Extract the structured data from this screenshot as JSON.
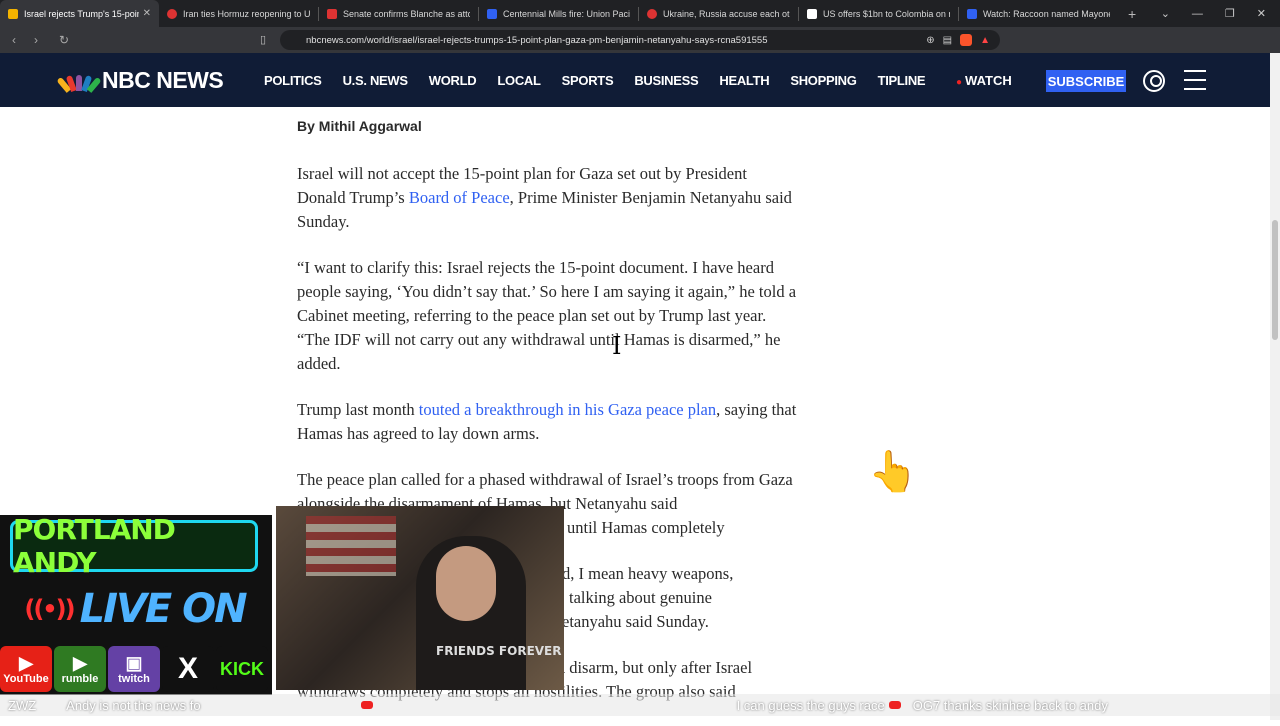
{
  "browser": {
    "tabs": [
      {
        "title": "Israel rejects Trump's 15-point p",
        "active": true,
        "favicon_color": "#f4b400"
      },
      {
        "title": "Iran ties Hormuz reopening to US c",
        "active": false,
        "favicon_color": "#d33"
      },
      {
        "title": "Senate confirms Blanche as attorne",
        "active": false,
        "favicon_color": "#d33"
      },
      {
        "title": "Centennial Mills fire: Union Pacific p",
        "active": false,
        "favicon_color": "#3061f2"
      },
      {
        "title": "Ukraine, Russia accuse each other o",
        "active": false,
        "favicon_color": "#d33"
      },
      {
        "title": "US offers $1bn to Colombia on new",
        "active": false,
        "favicon_color": "#fff"
      },
      {
        "title": "Watch: Raccoon named Mayonesia",
        "active": false,
        "favicon_color": "#3061f2"
      }
    ],
    "url": "nbcnews.com/world/israel/israel-rejects-trumps-15-point-plan-gaza-pm-benjamin-netanyahu-says-rcna591555"
  },
  "site": {
    "logo": "NBC NEWS",
    "nav": [
      "POLITICS",
      "U.S. NEWS",
      "WORLD",
      "LOCAL",
      "SPORTS",
      "BUSINESS",
      "HEALTH",
      "SHOPPING",
      "TIPLINE"
    ],
    "watch": "WATCH",
    "subscribe": "SUBSCRIBE"
  },
  "article": {
    "byline": "By Mithil Aggarwal",
    "p1_a": "Israel will not accept the 15-point plan for Gaza set out by President Donald Trump’s ",
    "p1_link": "Board of Peace",
    "p1_b": ", Prime Minister Benjamin Netanyahu said Sunday.",
    "p2": "“I want to clarify this: Israel rejects the 15-point document. I have heard people saying, ‘You didn’t say that.’ So here I am saying it again,” he told a Cabinet meeting, referring to the peace plan set out by Trump last year. “The IDF will not carry out any withdrawal until Hamas is disarmed,” he added.",
    "p3_a": "Trump last month ",
    "p3_link": "touted a breakthrough in his Gaza peace plan",
    "p3_b": ", saying that Hamas has agreed to lay down arms.",
    "p4": "The peace plan called for a phased withdrawal of Israel’s troops from Gaza alongside the disarmament of Hamas, but Netanyahu said",
    "p4_tail": "until Hamas completely",
    "p5_a": "d, I mean heavy weapons,",
    "p5_b": "talking about genuine",
    "p5_c": "etanyahu said Sunday.",
    "p6": "Hamas said last month said that it would disarm, but only after Israel withdraws completely and stops all hostilities. The group also said"
  },
  "overlay": {
    "brand_line1": "PORTLAND ANDY",
    "brand_line2": "LIVE ON",
    "socials": [
      {
        "name": "YouTube",
        "color": "#e62117",
        "icon": "▶"
      },
      {
        "name": "rumble",
        "color": "#2f7a22",
        "icon": "▶"
      },
      {
        "name": "twitch",
        "color": "#6441a5",
        "icon": "▣"
      },
      {
        "name": "",
        "color": "#111111",
        "icon": "X"
      },
      {
        "name": "KICK",
        "color": "#111111",
        "icon": ""
      }
    ],
    "shirt_text": "FRIENDS FOREVER",
    "ticker": [
      "ZWZ",
      "Andy is not the news fo",
      "I can guess the guys race",
      "OG7 thanks skinhee back to andy"
    ]
  }
}
